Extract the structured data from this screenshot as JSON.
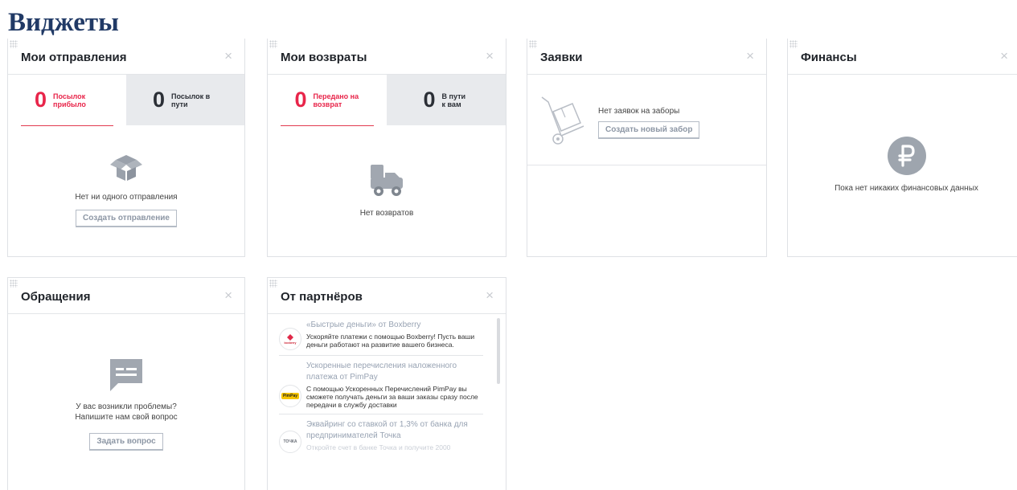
{
  "page": {
    "title": "Виджеты"
  },
  "shipments": {
    "title": "Мои отправления",
    "close": "×",
    "arrived_count": "0",
    "arrived_label": "Посылок прибыло",
    "transit_count": "0",
    "transit_label": "Посылок в пути",
    "empty_text": "Нет ни одного отправления",
    "button": "Создать отправление",
    "icon": "box-icon"
  },
  "returns": {
    "title": "Мои возвраты",
    "close": "×",
    "sent_count": "0",
    "sent_label": "Передано на возврат",
    "transit_count": "0",
    "transit_label": "В пути к вам",
    "empty_text": "Нет возвратов",
    "icon": "truck-icon"
  },
  "requests": {
    "title": "Заявки",
    "close": "×",
    "empty_text": "Нет заявок на заборы",
    "button": "Создать новый забор",
    "icon": "hand-truck-icon"
  },
  "finance": {
    "title": "Финансы",
    "close": "×",
    "empty_text": "Пока нет никаких финансовых данных",
    "icon": "ruble-icon"
  },
  "support": {
    "title": "Обращения",
    "close": "×",
    "line1": "У вас возникли проблемы?",
    "line2": "Напишите нам свой вопрос",
    "button": "Задать вопрос",
    "icon": "chat-icon"
  },
  "partners": {
    "title": "От партнёров",
    "close": "×",
    "items": [
      {
        "logo": "boxberry",
        "title": "«Быстрые деньги» от Boxberry",
        "desc": "Ускоряйте платежи с помощью Boxberry! Пусть ваши деньги работают на развитие вашего бизнеса."
      },
      {
        "logo": "PimPay",
        "title": "Ускоренные перечисления наложенного платежа от PimPay",
        "desc": "С помощью Ускоренных Перечислений PimPay вы сможете получать деньги за ваши заказы сразу после передачи в службу доставки"
      },
      {
        "logo": "ТОЧКА",
        "title": "Эквайринг со ставкой от 1,3% от банка для предпринимателей Точка",
        "desc": "Откройте счет в банке Точка и получите 2000"
      }
    ]
  },
  "colors": {
    "accent": "#e8254a",
    "title": "#213a66",
    "muted": "#8d97a5"
  }
}
